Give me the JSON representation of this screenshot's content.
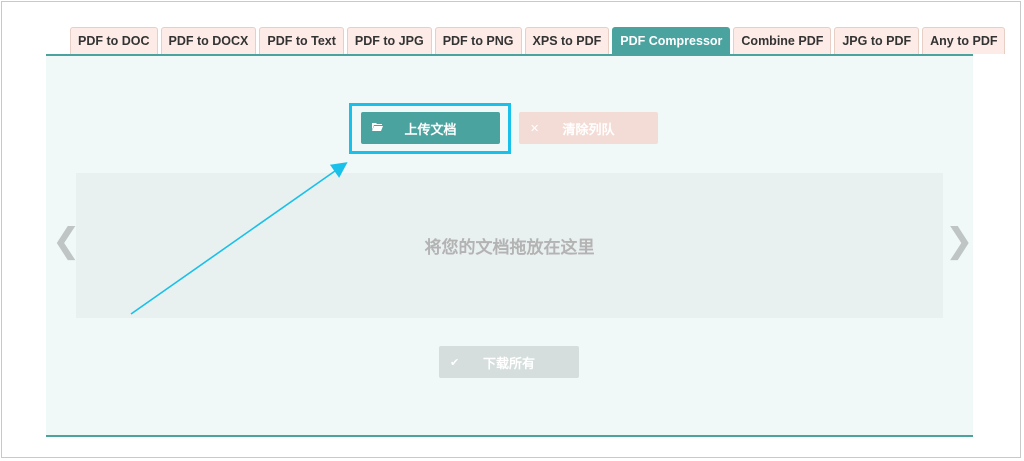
{
  "tabs": [
    {
      "label": "PDF to DOC",
      "active": false
    },
    {
      "label": "PDF to DOCX",
      "active": false
    },
    {
      "label": "PDF to Text",
      "active": false
    },
    {
      "label": "PDF to JPG",
      "active": false
    },
    {
      "label": "PDF to PNG",
      "active": false
    },
    {
      "label": "XPS to PDF",
      "active": false
    },
    {
      "label": "PDF Compressor",
      "active": true
    },
    {
      "label": "Combine PDF",
      "active": false
    },
    {
      "label": "JPG to PDF",
      "active": false
    },
    {
      "label": "Any to PDF",
      "active": false
    }
  ],
  "toolbar": {
    "upload_label": "上传文档",
    "upload_icon": "folder-open-icon",
    "clear_label": "清除列队",
    "clear_icon": "close-icon"
  },
  "dropzone": {
    "text": "将您的文档拖放在这里"
  },
  "download": {
    "label": "下载所有",
    "icon": "checkmark-icon"
  },
  "nav": {
    "prev_glyph": "❮",
    "next_glyph": "❯"
  },
  "colors": {
    "accent": "#4ba3a0",
    "highlight": "#19c0ea",
    "tab_bg": "#fcebe6"
  }
}
